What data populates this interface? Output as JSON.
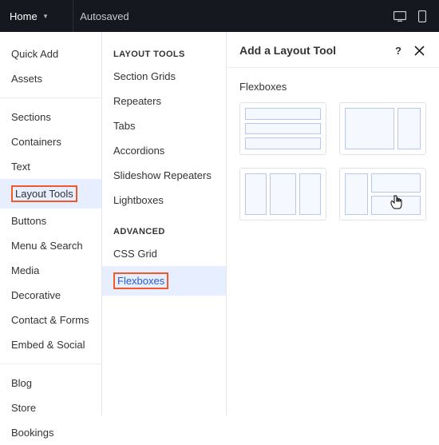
{
  "topbar": {
    "home": "Home",
    "autosaved": "Autosaved"
  },
  "sidebar1": {
    "quickAdd": "Quick Add",
    "assets": "Assets",
    "sections": "Sections",
    "containers": "Containers",
    "text": "Text",
    "layoutTools": "Layout Tools",
    "buttons": "Buttons",
    "menuSearch": "Menu & Search",
    "media": "Media",
    "decorative": "Decorative",
    "contactForms": "Contact & Forms",
    "embedSocial": "Embed & Social",
    "blog": "Blog",
    "store": "Store",
    "bookings": "Bookings"
  },
  "sidebar2": {
    "group1": "LAYOUT TOOLS",
    "sectionGrids": "Section Grids",
    "repeaters": "Repeaters",
    "tabs": "Tabs",
    "accordions": "Accordions",
    "slideshowRepeaters": "Slideshow Repeaters",
    "lightboxes": "Lightboxes",
    "group2": "ADVANCED",
    "cssGrid": "CSS Grid",
    "flexboxes": "Flexboxes"
  },
  "panel": {
    "title": "Add a Layout Tool",
    "section": "Flexboxes"
  }
}
